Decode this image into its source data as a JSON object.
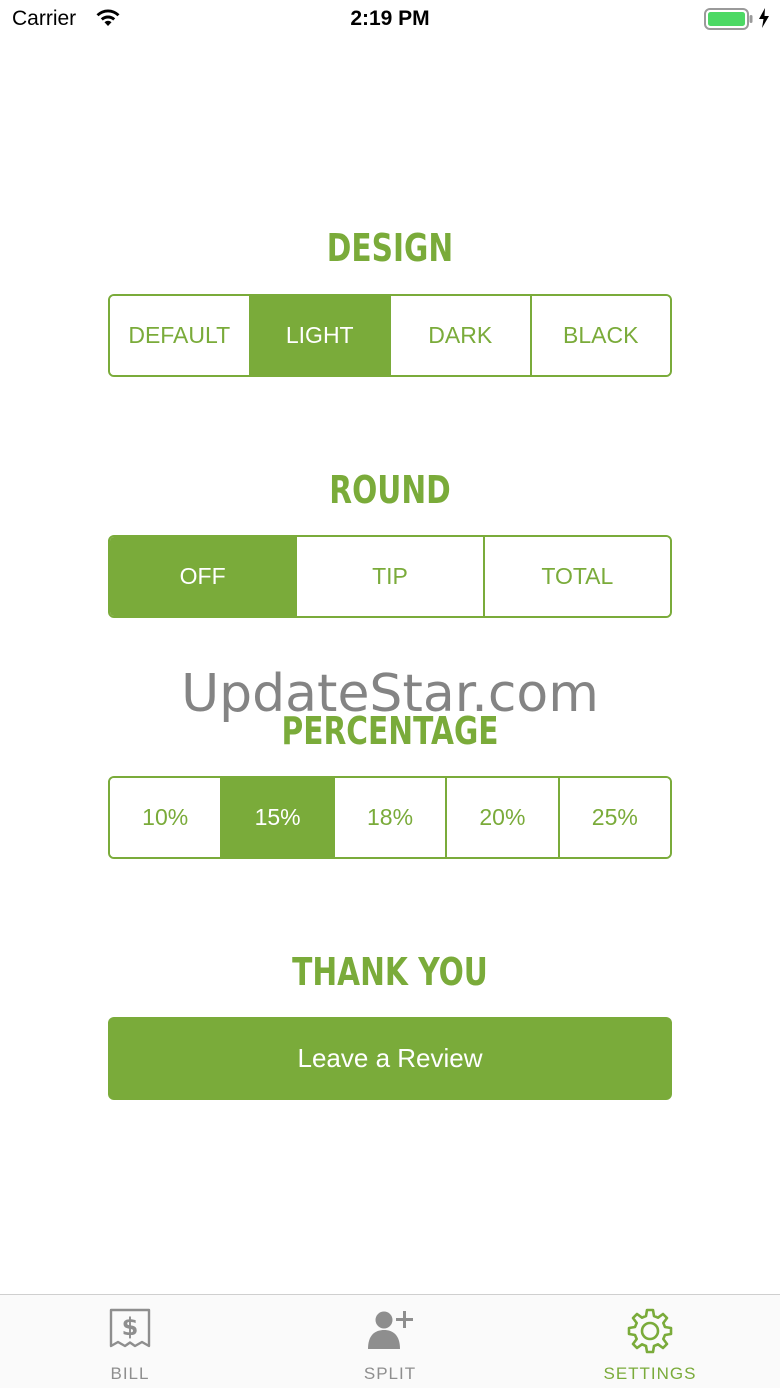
{
  "status_bar": {
    "carrier": "Carrier",
    "time": "2:19 PM"
  },
  "colors": {
    "accent": "#7aab3a",
    "inactive": "#8e8e8e"
  },
  "design": {
    "title": "DESIGN",
    "options": [
      "DEFAULT",
      "LIGHT",
      "DARK",
      "BLACK"
    ],
    "selected": "LIGHT"
  },
  "round": {
    "title": "ROUND",
    "options": [
      "OFF",
      "TIP",
      "TOTAL"
    ],
    "selected": "OFF"
  },
  "percentage": {
    "title": "PERCENTAGE",
    "options": [
      "10%",
      "15%",
      "18%",
      "20%",
      "25%"
    ],
    "selected": "15%"
  },
  "thank_you": {
    "title": "THANK YOU",
    "button_label": "Leave a Review"
  },
  "watermark": "UpdateStar.com",
  "tab_bar": {
    "tabs": [
      {
        "label": "BILL",
        "icon": "receipt-dollar-icon"
      },
      {
        "label": "SPLIT",
        "icon": "add-person-icon"
      },
      {
        "label": "SETTINGS",
        "icon": "gear-icon"
      }
    ],
    "active": "SETTINGS"
  }
}
